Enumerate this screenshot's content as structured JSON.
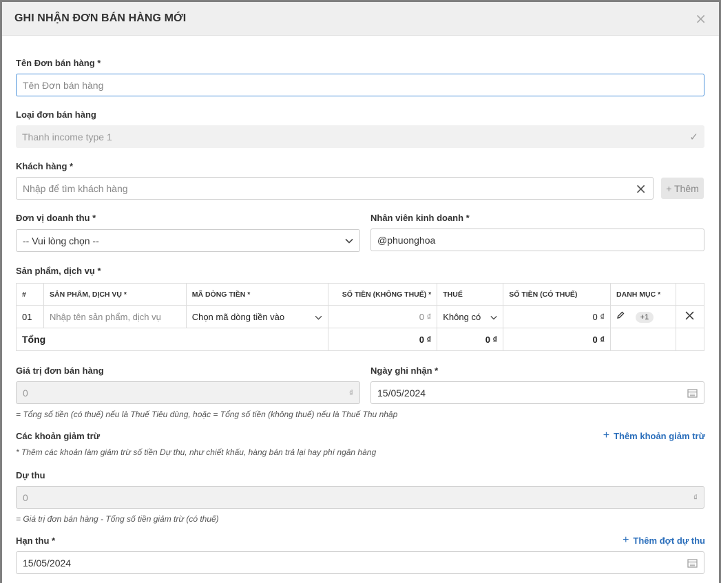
{
  "modal": {
    "title": "GHI NHẬN ĐƠN BÁN HÀNG MỚI",
    "close_symbol": "×"
  },
  "form": {
    "order_name": {
      "label": "Tên Đơn bán hàng *",
      "placeholder": "Tên Đơn bán hàng"
    },
    "order_type": {
      "label": "Loại đơn bán hàng",
      "value": "Thanh income type 1",
      "check": "✓"
    },
    "customer": {
      "label": "Khách hàng *",
      "placeholder": "Nhập để tìm khách hàng",
      "clear": "×",
      "add_label": "+ Thêm"
    },
    "revenue_unit": {
      "label": "Đơn vị doanh thu *",
      "value": "-- Vui lòng chọn --"
    },
    "sales_staff": {
      "label": "Nhân viên kinh doanh *",
      "value": "@phuonghoa"
    },
    "products": {
      "label": "Sản phẩm, dịch vụ *",
      "columns": [
        "#",
        "SẢN PHẨM, DỊCH VỤ *",
        "MÃ DÒNG TIỀN *",
        "SỐ TIỀN (KHÔNG THUẾ) *",
        "THUẾ",
        "SỐ TIỀN (CÓ THUẾ)",
        "DANH MỤC *"
      ],
      "rows": [
        {
          "index": "01",
          "product_placeholder": "Nhập tên sản phẩm, dịch vụ",
          "cashflow": "Chọn mã dòng tiền vào",
          "amount_no_tax": "0 ₫",
          "tax": "Không có",
          "amount_with_tax": "0 ₫",
          "category_badge": "+1"
        }
      ],
      "total": {
        "label": "Tổng",
        "amount_no_tax": "0 ₫",
        "tax": "0 ₫",
        "amount_with_tax": "0 ₫"
      }
    },
    "order_value": {
      "label": "Giá trị đơn bán hàng",
      "value": "0",
      "currency": "₫",
      "hint": "= Tổng số tiền (có thuế) nếu là Thuế Tiêu dùng, hoặc = Tổng số tiền (không thuế) nếu là Thuế Thu nhập"
    },
    "record_date": {
      "label": "Ngày ghi nhận *",
      "value": "15/05/2024"
    },
    "deductions": {
      "label": "Các khoản giảm trừ",
      "link": "Thêm khoản giảm trừ",
      "hint": "* Thêm các khoản làm giảm trừ số tiền Dự thu, như chiết khấu, hàng bán trả lại hay phí ngân hàng"
    },
    "expected_income": {
      "label": "Dự thu",
      "value": "0",
      "currency": "₫",
      "hint": "= Giá trị đơn bán hàng - Tổng số tiền giảm trừ (có thuế)"
    },
    "due_date": {
      "label": "Hạn thu *",
      "value": "15/05/2024",
      "link": "Thêm đợt dự thu"
    }
  }
}
